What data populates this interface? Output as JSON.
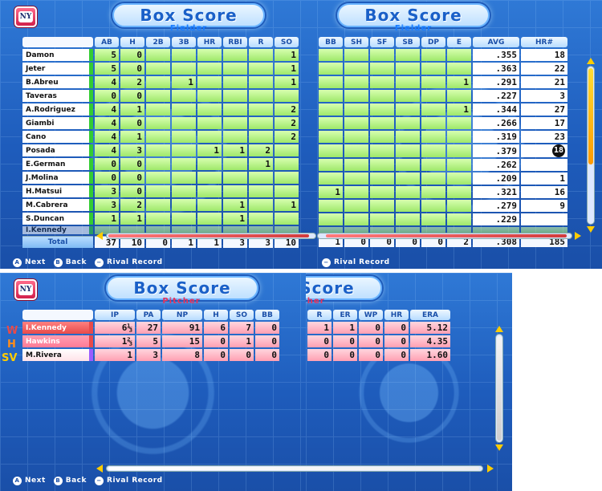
{
  "title": "Box Score",
  "fielder": {
    "subtitle": "Fielder",
    "columns_left": [
      "AB",
      "H",
      "2B",
      "3B",
      "HR",
      "RBI",
      "R",
      "SO"
    ],
    "columns_right": [
      "BB",
      "SH",
      "SF",
      "SB",
      "DP",
      "E",
      "AVG",
      "HR#"
    ],
    "players": [
      {
        "name": "Damon",
        "ab": "5",
        "h": "0",
        "b2": "",
        "b3": "",
        "hr": "",
        "rbi": "",
        "r": "",
        "so": "1",
        "bb": "",
        "sh": "",
        "sf": "",
        "sb": "",
        "dp": "",
        "e": "",
        "avg": ".355",
        "hrn": "18"
      },
      {
        "name": "Jeter",
        "ab": "5",
        "h": "0",
        "b2": "",
        "b3": "",
        "hr": "",
        "rbi": "",
        "r": "",
        "so": "1",
        "bb": "",
        "sh": "",
        "sf": "",
        "sb": "",
        "dp": "",
        "e": "",
        "avg": ".363",
        "hrn": "22"
      },
      {
        "name": "B.Abreu",
        "ab": "4",
        "h": "2",
        "b2": "",
        "b3": "1",
        "hr": "",
        "rbi": "",
        "r": "",
        "so": "1",
        "bb": "",
        "sh": "",
        "sf": "",
        "sb": "",
        "dp": "",
        "e": "1",
        "avg": ".291",
        "hrn": "21"
      },
      {
        "name": "Taveras",
        "ab": "0",
        "h": "0",
        "b2": "",
        "b3": "",
        "hr": "",
        "rbi": "",
        "r": "",
        "so": "",
        "bb": "",
        "sh": "",
        "sf": "",
        "sb": "",
        "dp": "",
        "e": "",
        "avg": ".227",
        "hrn": "3"
      },
      {
        "name": "A.Rodriguez",
        "ab": "4",
        "h": "1",
        "b2": "",
        "b3": "",
        "hr": "",
        "rbi": "",
        "r": "",
        "so": "2",
        "bb": "",
        "sh": "",
        "sf": "",
        "sb": "",
        "dp": "",
        "e": "1",
        "avg": ".344",
        "hrn": "27"
      },
      {
        "name": "Giambi",
        "ab": "4",
        "h": "0",
        "b2": "",
        "b3": "",
        "hr": "",
        "rbi": "",
        "r": "",
        "so": "2",
        "bb": "",
        "sh": "",
        "sf": "",
        "sb": "",
        "dp": "",
        "e": "",
        "avg": ".266",
        "hrn": "17"
      },
      {
        "name": "Cano",
        "ab": "4",
        "h": "1",
        "b2": "",
        "b3": "",
        "hr": "",
        "rbi": "",
        "r": "",
        "so": "2",
        "bb": "",
        "sh": "",
        "sf": "",
        "sb": "",
        "dp": "",
        "e": "",
        "avg": ".319",
        "hrn": "23"
      },
      {
        "name": "Posada",
        "ab": "4",
        "h": "3",
        "b2": "",
        "b3": "",
        "hr": "1",
        "rbi": "1",
        "r": "2",
        "so": "",
        "bb": "",
        "sh": "",
        "sf": "",
        "sb": "",
        "dp": "",
        "e": "",
        "avg": ".379",
        "hrn": "18"
      },
      {
        "name": "E.German",
        "ab": "0",
        "h": "0",
        "b2": "",
        "b3": "",
        "hr": "",
        "rbi": "",
        "r": "1",
        "so": "",
        "bb": "",
        "sh": "",
        "sf": "",
        "sb": "",
        "dp": "",
        "e": "",
        "avg": ".262",
        "hrn": ""
      },
      {
        "name": "J.Molina",
        "ab": "0",
        "h": "0",
        "b2": "",
        "b3": "",
        "hr": "",
        "rbi": "",
        "r": "",
        "so": "",
        "bb": "",
        "sh": "",
        "sf": "",
        "sb": "",
        "dp": "",
        "e": "",
        "avg": ".209",
        "hrn": "1"
      },
      {
        "name": "H.Matsui",
        "ab": "3",
        "h": "0",
        "b2": "",
        "b3": "",
        "hr": "",
        "rbi": "",
        "r": "",
        "so": "",
        "bb": "1",
        "sh": "",
        "sf": "",
        "sb": "",
        "dp": "",
        "e": "",
        "avg": ".321",
        "hrn": "16"
      },
      {
        "name": "M.Cabrera",
        "ab": "3",
        "h": "2",
        "b2": "",
        "b3": "",
        "hr": "",
        "rbi": "1",
        "r": "",
        "so": "1",
        "bb": "",
        "sh": "",
        "sf": "",
        "sb": "",
        "dp": "",
        "e": "",
        "avg": ".279",
        "hrn": "9"
      },
      {
        "name": "S.Duncan",
        "ab": "1",
        "h": "1",
        "b2": "",
        "b3": "",
        "hr": "",
        "rbi": "1",
        "r": "",
        "so": "",
        "bb": "",
        "sh": "",
        "sf": "",
        "sb": "",
        "dp": "",
        "e": "",
        "avg": ".229",
        "hrn": ""
      }
    ],
    "cut_name": "I.Kennedy",
    "total": {
      "label": "Total",
      "ab": "37",
      "h": "10",
      "b2": "0",
      "b3": "1",
      "hr": "1",
      "rbi": "3",
      "r": "3",
      "so": "10",
      "bb": "1",
      "sh": "0",
      "sf": "0",
      "sb": "0",
      "dp": "0",
      "e": "2",
      "avg": ".308",
      "hrn": "185"
    }
  },
  "pitcher": {
    "subtitle": "Pitcher",
    "columns": [
      "IP",
      "PA",
      "NP",
      "H",
      "SO",
      "BB",
      "R",
      "ER",
      "WP",
      "HR",
      "ERA"
    ],
    "players": [
      {
        "decision": "W",
        "name": "I.Kennedy",
        "ip": "6⅓",
        "pa": "27",
        "np": "91",
        "h": "6",
        "so": "7",
        "bb": "0",
        "r": "1",
        "er": "1",
        "wp": "0",
        "hr": "0",
        "era": "5.12"
      },
      {
        "decision": "H",
        "name": "Hawkins",
        "ip": "1⅔",
        "pa": "5",
        "np": "15",
        "h": "0",
        "so": "1",
        "bb": "0",
        "r": "0",
        "er": "0",
        "wp": "0",
        "hr": "0",
        "era": "4.35"
      },
      {
        "decision": "SV",
        "name": "M.Rivera",
        "ip": "1",
        "pa": "3",
        "np": "8",
        "h": "0",
        "so": "0",
        "bb": "0",
        "r": "0",
        "er": "0",
        "wp": "0",
        "hr": "0",
        "era": "1.60"
      }
    ]
  },
  "footer": {
    "next": "Next",
    "back": "Back",
    "rival": "Rival Record",
    "btn_a": "A",
    "btn_b": "B",
    "btn_minus": "−"
  },
  "logo": "NY",
  "colors": {
    "accent": "#1e5cbc",
    "fielder_green": "#9ee86a",
    "pitcher_pink": "#ff9fb2",
    "win": "#e84a4a",
    "hold": "#ff8c1a",
    "save": "#ffcc00"
  }
}
